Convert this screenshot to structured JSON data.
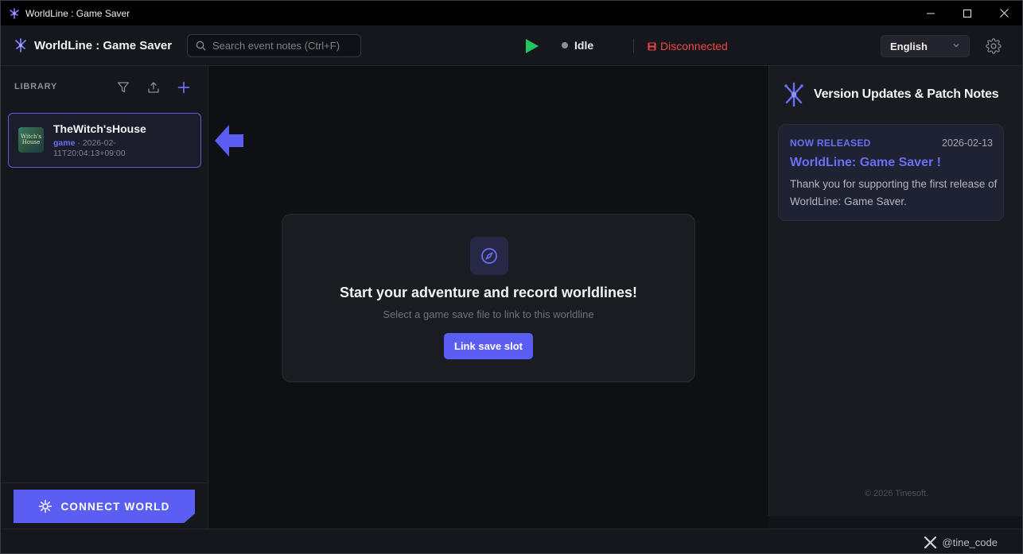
{
  "window": {
    "title": "WorldLine : Game Saver"
  },
  "header": {
    "brand": "WorldLine : Game Saver",
    "search_placeholder": "Search event notes (Ctrl+F)",
    "status": "Idle",
    "connection": "Disconnected",
    "language": "English"
  },
  "sidebar": {
    "heading": "LIBRARY",
    "items": [
      {
        "title": "TheWitch'sHouse",
        "thumb_text": "Witch's House",
        "tag": "game",
        "meta": " · 2026-02-11T20:04:13+09:00"
      }
    ],
    "connect_label": "CONNECT WORLD"
  },
  "main": {
    "empty_title": "Start your adventure and record worldlines!",
    "empty_subtitle": "Select a game save file to link to this worldline",
    "link_button": "Link save slot"
  },
  "right_panel": {
    "title": "Version Updates & Patch Notes",
    "notes": [
      {
        "tag": "NOW RELEASED",
        "date": "2026-02-13",
        "title": "WorldLine: Game Saver !",
        "body": "Thank you for supporting the first release of WorldLine: Game Saver."
      }
    ],
    "copyright": "© 2026 Tinesoft."
  },
  "footer": {
    "handle": "@tine_code"
  },
  "colors": {
    "accent": "#5b5ef2",
    "play": "#22c55e",
    "error": "#ef4444"
  }
}
